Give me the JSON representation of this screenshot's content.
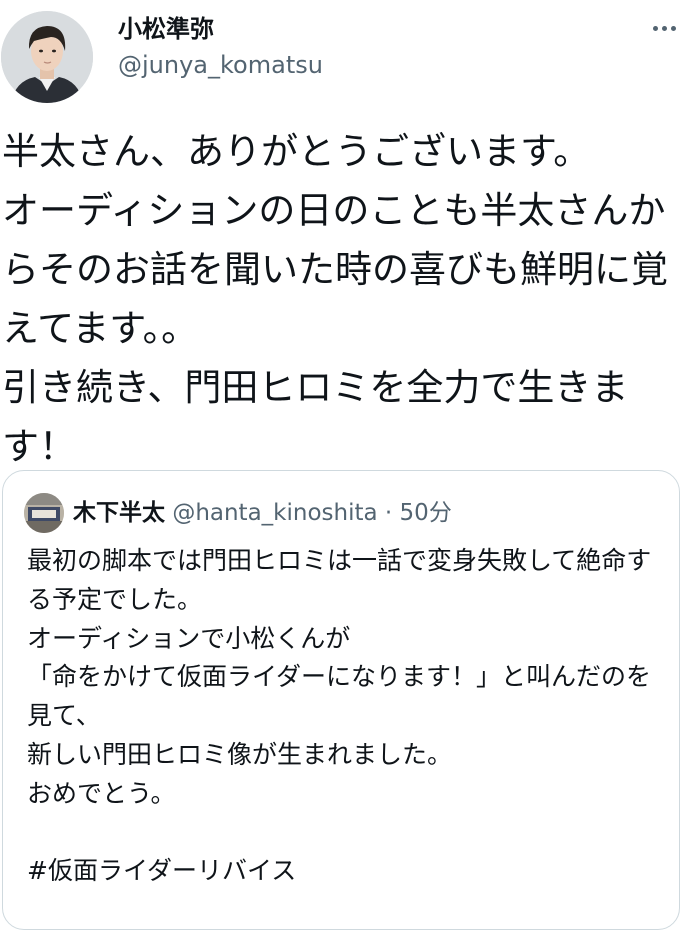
{
  "author": {
    "name": "小松準弥",
    "handle": "@junya_komatsu"
  },
  "more_icon": "more-horizontal-icon",
  "tweet_text": "半太さん、ありがとうございます。\nオーディションの日のことも半太さんからそのお話を聞いた時の喜びも鮮明に覚えてます。。\n引き続き、門田ヒロミを全力で生きます！",
  "quote": {
    "name": "木下半太",
    "handle": "@hanta_kinoshita",
    "separator": "·",
    "time": "50分",
    "text": "最初の脚本では門田ヒロミは一話で変身失敗して絶命する予定でした。\nオーディションで小松くんが\n「命をかけて仮面ライダーになります！」と叫んだのを見て、\n新しい門田ヒロミ像が生まれました。\nおめでとう。\n\n#仮面ライダーリバイス"
  },
  "colors": {
    "text_primary": "#0f1419",
    "text_secondary": "#536471",
    "border": "#cfd9de"
  }
}
